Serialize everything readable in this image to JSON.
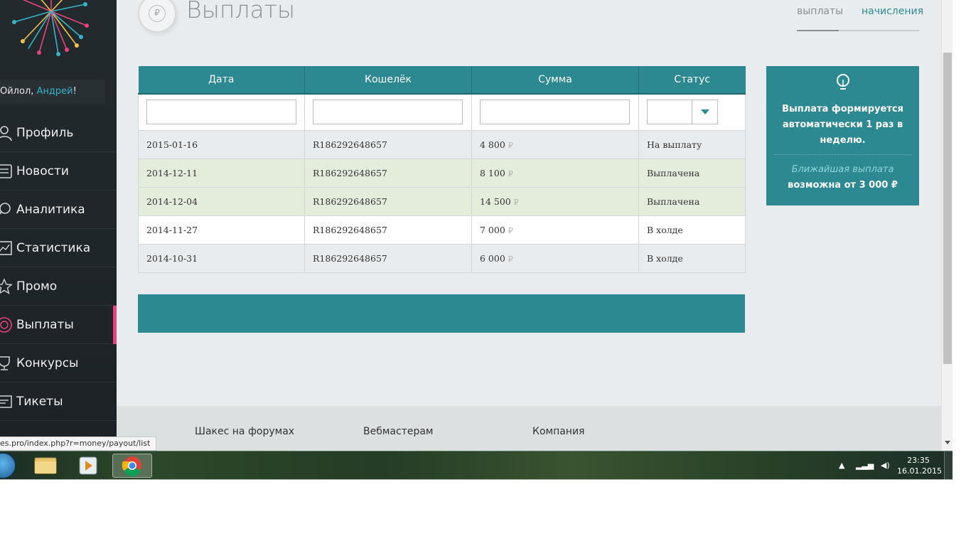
{
  "user": {
    "greeting_prefix": "Ойлол, ",
    "name": "Андрей",
    "greeting_suffix": "!"
  },
  "sidebar": {
    "items": [
      {
        "label": "Профиль",
        "icon": "user-icon"
      },
      {
        "label": "Новости",
        "icon": "news-icon"
      },
      {
        "label": "Аналитика",
        "icon": "search-icon"
      },
      {
        "label": "Статистика",
        "icon": "chart-icon"
      },
      {
        "label": "Промо",
        "icon": "star-icon"
      },
      {
        "label": "Выплаты",
        "icon": "coin-icon",
        "active": true
      },
      {
        "label": "Конкурсы",
        "icon": "trophy-icon"
      },
      {
        "label": "Тикеты",
        "icon": "ticket-icon"
      }
    ]
  },
  "page": {
    "title": "Выплаты",
    "badge_symbol": "₽"
  },
  "tabs": [
    {
      "label": "выплаты",
      "active": true
    },
    {
      "label": "начисления",
      "active": false
    }
  ],
  "table": {
    "headers": [
      "Дата",
      "Кошелёк",
      "Сумма",
      "Статус"
    ],
    "currency": "₽",
    "rows": [
      {
        "date": "2015-01-16",
        "wallet": "R186292648657",
        "amount": "4 800",
        "status": "На выплату"
      },
      {
        "date": "2014-12-11",
        "wallet": "R186292648657",
        "amount": "8 100",
        "status": "Выплачена"
      },
      {
        "date": "2014-12-04",
        "wallet": "R186292648657",
        "amount": "14 500",
        "status": "Выплачена"
      },
      {
        "date": "2014-11-27",
        "wallet": "R186292648657",
        "amount": "7 000",
        "status": "В холде"
      },
      {
        "date": "2014-10-31",
        "wallet": "R186292648657",
        "amount": "6 000",
        "status": "В холде"
      }
    ]
  },
  "info": {
    "main": "Выплата формируется автоматически 1 раз в неделю.",
    "next_label": "Ближайшая выплата",
    "next_amount": "возможна от 3 000 ₽"
  },
  "footer": {
    "links": [
      "Шакес на форумах",
      "Вебмастерам",
      "Компания"
    ]
  },
  "status_bar": {
    "url": "es.pro/index.php?r=money/payout/list"
  },
  "taskbar": {
    "time": "23:35",
    "date": "16.01.2015"
  },
  "colors": {
    "accent": "#2c8991",
    "active_marker": "#e8427c",
    "paid_row": "#e4eddc"
  }
}
